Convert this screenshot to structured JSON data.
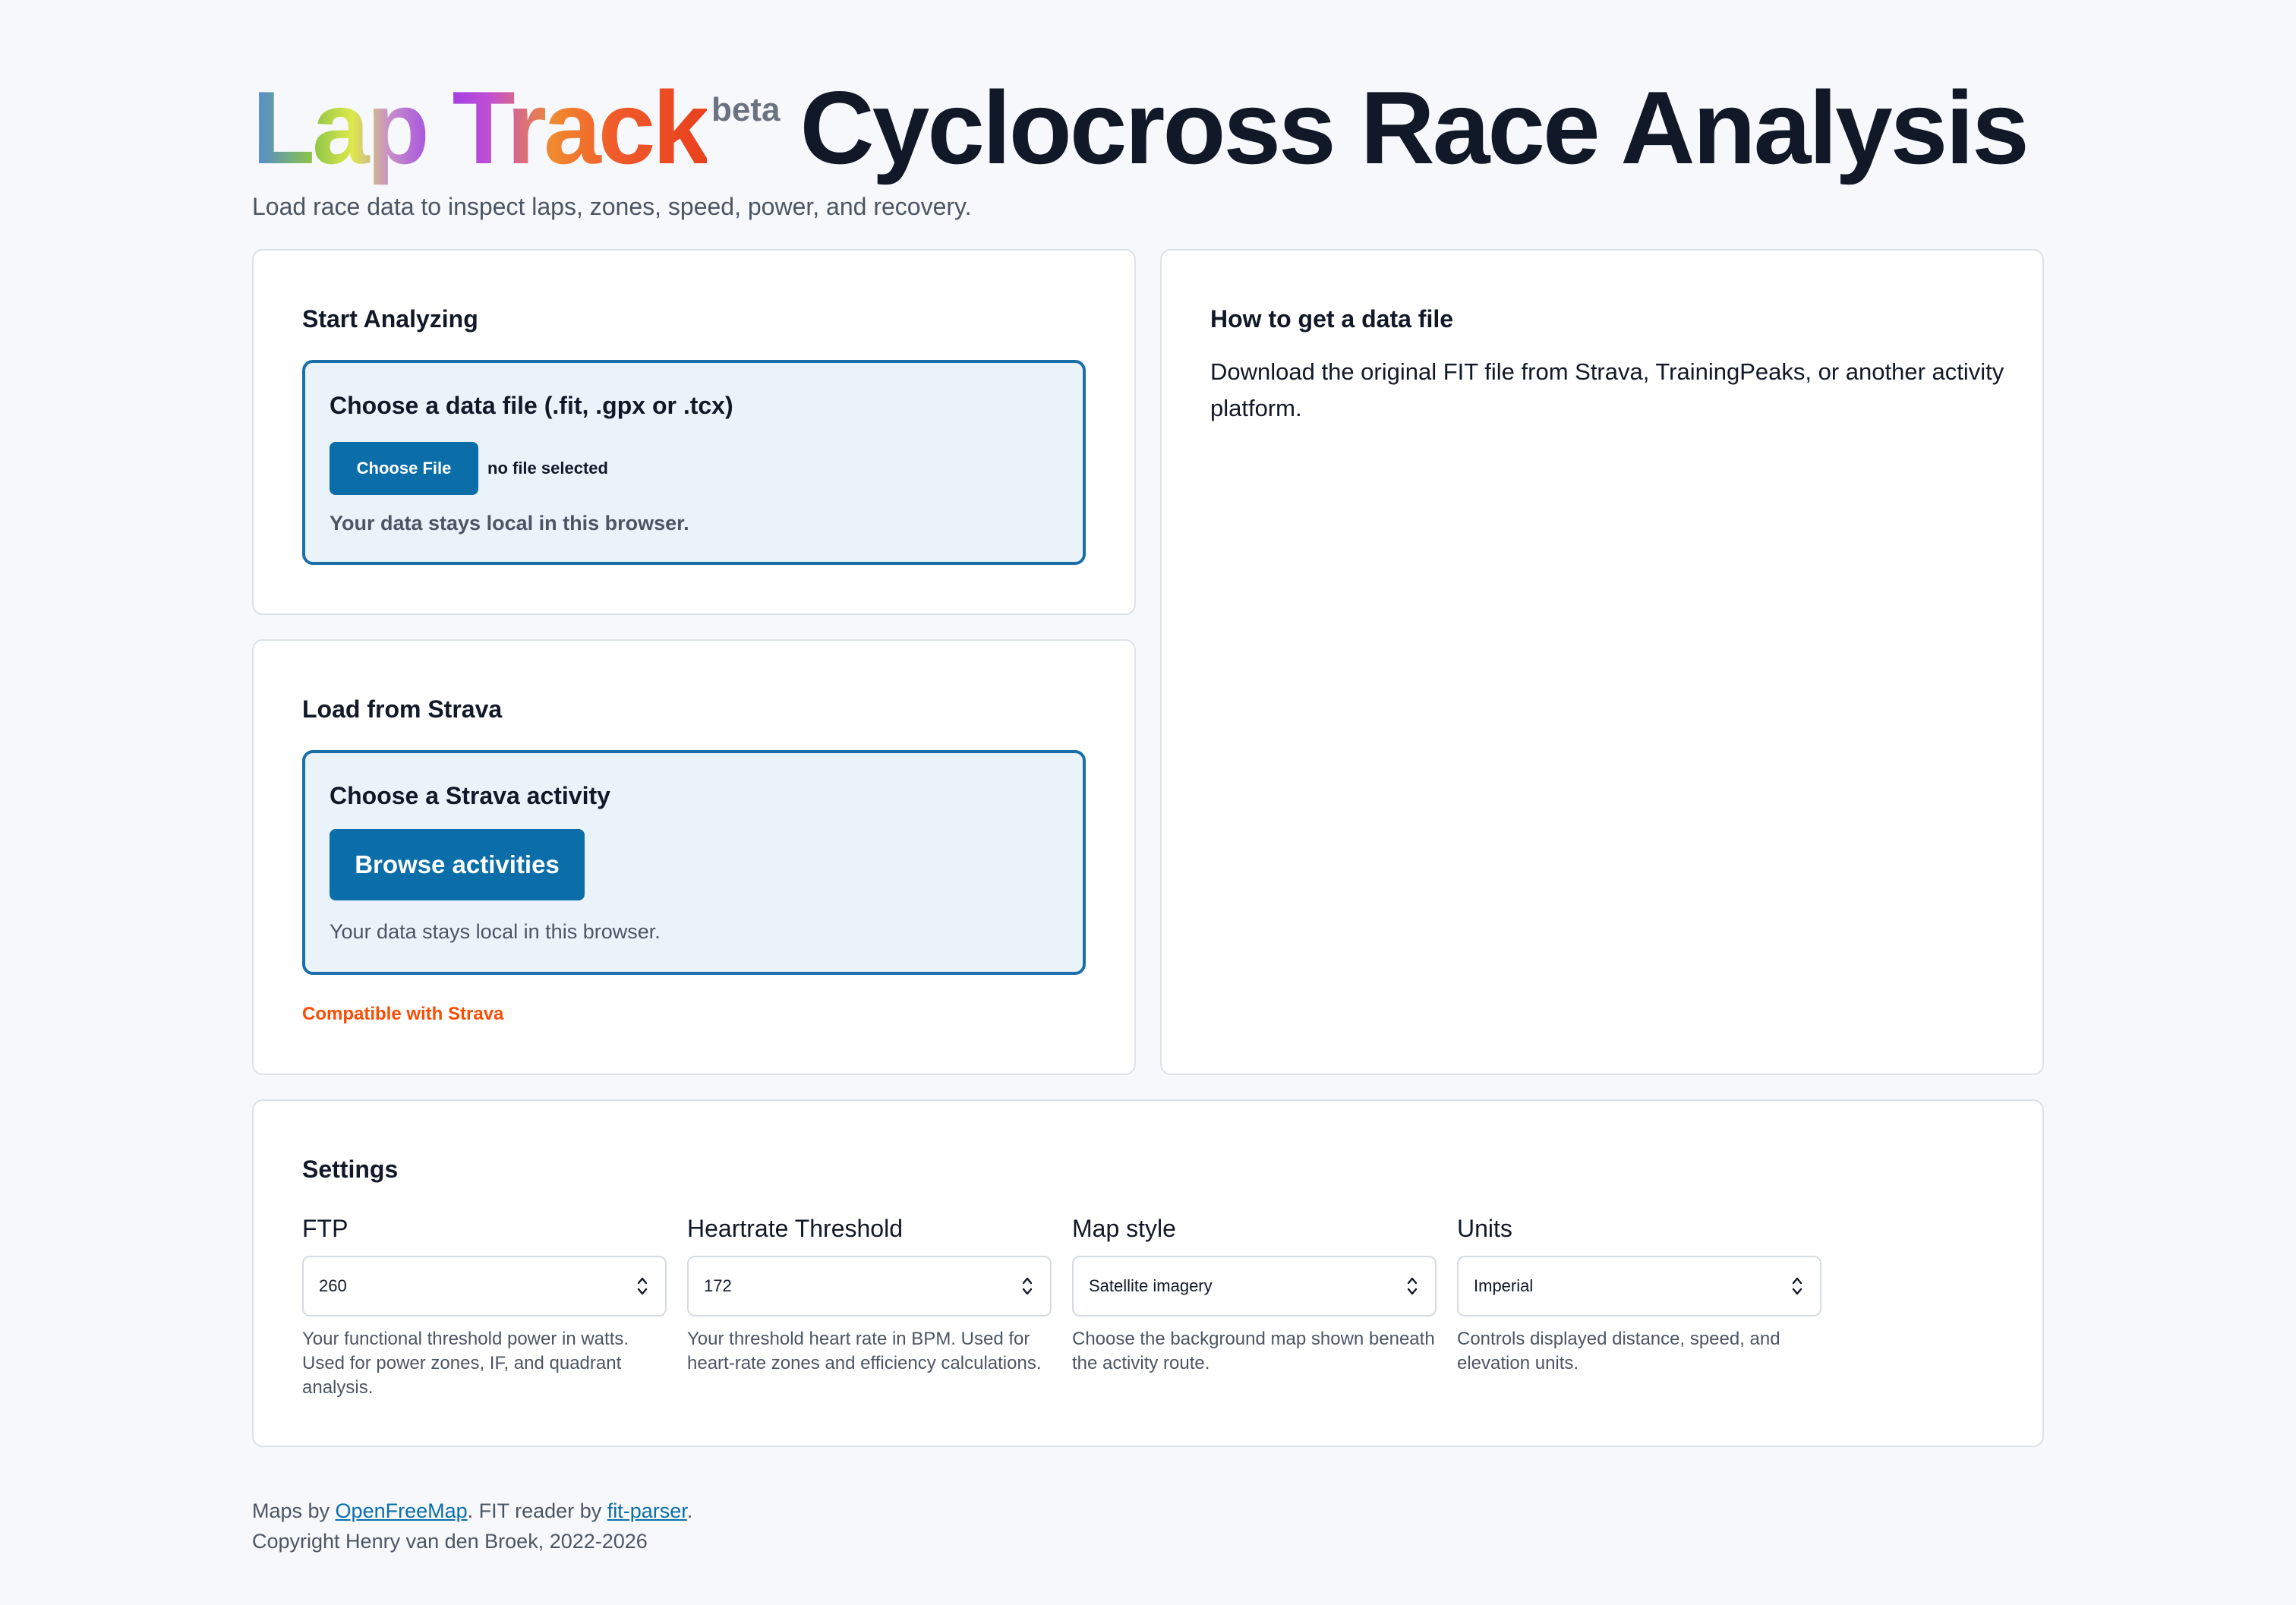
{
  "header": {
    "logo": "Lap Track",
    "badge": "beta",
    "title": "Cyclocross Race Analysis",
    "subtitle": "Load race data to inspect laps, zones, speed, power, and recovery."
  },
  "start_card": {
    "title": "Start Analyzing",
    "dropzone_title": "Choose a data file (.fit, .gpx or .tcx)",
    "button_label": "Choose File",
    "file_status": "no file selected",
    "note": "Your data stays local in this browser."
  },
  "strava_card": {
    "title": "Load from Strava",
    "dropzone_title": "Choose a Strava activity",
    "button_label": "Browse activities",
    "note": "Your data stays local in this browser.",
    "compat": "Compatible with Strava"
  },
  "help_card": {
    "title": "How to get a data file",
    "text": "Download the original FIT file from Strava, TrainingPeaks, or another activity platform."
  },
  "settings": {
    "title": "Settings",
    "ftp": {
      "label": "FTP",
      "value": "260",
      "help": "Your functional threshold power in watts. Used for power zones, IF, and quadrant analysis."
    },
    "hr": {
      "label": "Heartrate Threshold",
      "value": "172",
      "help": "Your threshold heart rate in BPM. Used for heart-rate zones and efficiency calculations."
    },
    "map": {
      "label": "Map style",
      "value": "Satellite imagery",
      "help": "Choose the background map shown beneath the activity route."
    },
    "units": {
      "label": "Units",
      "value": "Imperial",
      "help": "Controls displayed distance, speed, and elevation units."
    }
  },
  "footer": {
    "maps_prefix": "Maps by ",
    "maps_link": "OpenFreeMap",
    "fit_prefix": ". FIT reader by ",
    "fit_link": "fit-parser",
    "fit_suffix": ".",
    "copyright": "Copyright Henry van den Broek, 2022-2026"
  },
  "colors": {
    "accent": "#0b6ea9",
    "strava": "#fc4c02",
    "background": "#f6f8fb"
  }
}
